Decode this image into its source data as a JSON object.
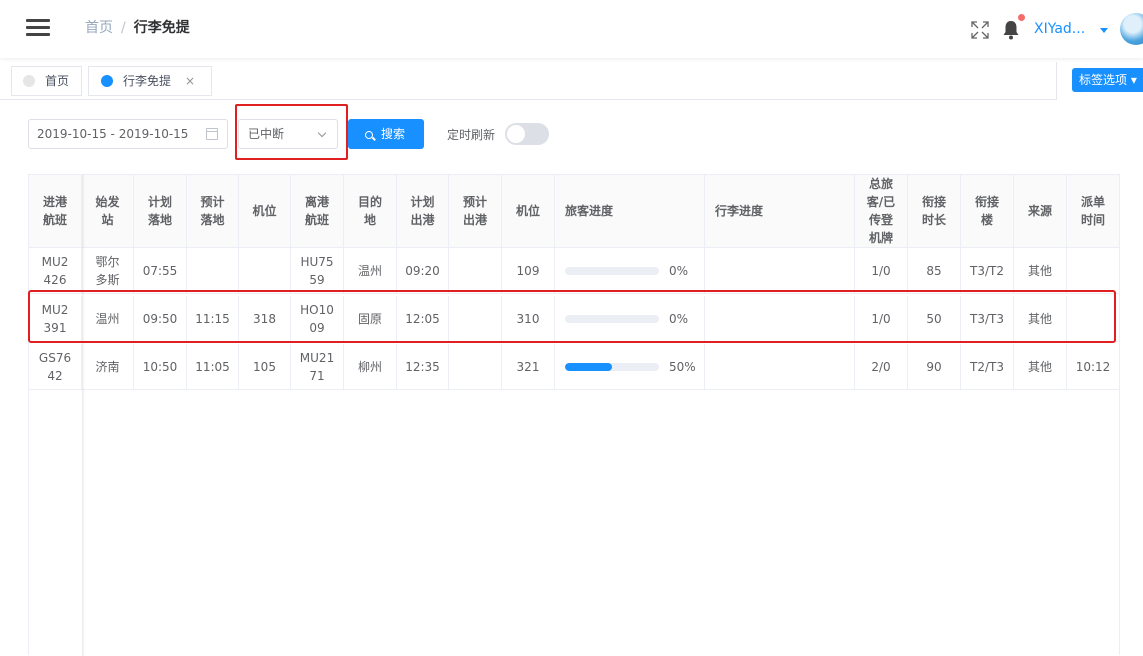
{
  "breadcrumb": {
    "home": "首页",
    "separator": "/",
    "current": "行李免提"
  },
  "header": {
    "username": "XIYad..."
  },
  "tags": {
    "home": "首页",
    "active": "行李免提",
    "close": "×",
    "options": "标签选项 ▾"
  },
  "filter": {
    "date_range": "2019-10-15 - 2019-10-15",
    "status_value": "已中断",
    "search_label": "搜索",
    "refresh_label": "定时刷新",
    "refresh_on": false
  },
  "colors": {
    "primary": "#1890ff",
    "highlight_box": "#e02020",
    "badge": "#f56c6c"
  },
  "table": {
    "headers": [
      "进港\n航班",
      "始发\n站",
      "计划\n落地",
      "预计\n落地",
      "机位",
      "离港\n航班",
      "目的\n地",
      "计划\n出港",
      "预计\n出港",
      "机位",
      "旅客进度",
      "行李进度",
      "总旅\n客/已\n传登\n机牌",
      "衔接\n时长",
      "衔接\n楼",
      "来源",
      "派单\n时间"
    ],
    "rows": [
      {
        "in_flight": "MU2\n426",
        "origin": "鄂尔\n多斯",
        "planned_land": "07:55",
        "est_land": "",
        "in_stand": "",
        "out_flight": "HU75\n59",
        "dest": "温州",
        "planned_dep": "09:20",
        "est_dep": "",
        "out_stand": "109",
        "pax_progress": "0%",
        "pax_progress_value": 0,
        "baggage_progress": "",
        "pax_board": "1/0",
        "connect_time": "85",
        "connect_terminal": "T3/T2",
        "source": "其他",
        "dispatch_time": ""
      },
      {
        "in_flight": "MU2\n391",
        "origin": "温州",
        "planned_land": "09:50",
        "est_land": "11:15",
        "in_stand": "318",
        "out_flight": "HO10\n09",
        "dest": "固原",
        "planned_dep": "12:05",
        "est_dep": "",
        "out_stand": "310",
        "pax_progress": "0%",
        "pax_progress_value": 0,
        "baggage_progress": "",
        "pax_board": "1/0",
        "connect_time": "50",
        "connect_terminal": "T3/T3",
        "source": "其他",
        "dispatch_time": ""
      },
      {
        "in_flight": "GS76\n42",
        "origin": "济南",
        "planned_land": "10:50",
        "est_land": "11:05",
        "in_stand": "105",
        "out_flight": "MU21\n71",
        "dest": "柳州",
        "planned_dep": "12:35",
        "est_dep": "",
        "out_stand": "321",
        "pax_progress": "50%",
        "pax_progress_value": 50,
        "baggage_progress": "",
        "pax_board": "2/0",
        "connect_time": "90",
        "connect_terminal": "T2/T3",
        "source": "其他",
        "dispatch_time": "10:12"
      }
    ]
  }
}
